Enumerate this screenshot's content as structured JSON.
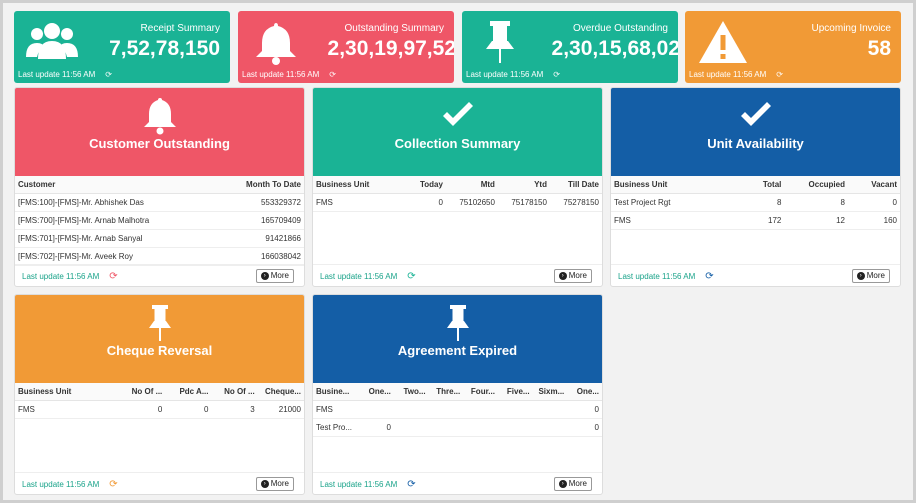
{
  "stats": [
    {
      "title": "Receipt Summary",
      "value": "7,52,78,150",
      "updated": "Last update 11:56 AM",
      "icon": "users-icon",
      "color": "#1ab395"
    },
    {
      "title": "Outstanding Summary",
      "value": "2,30,19,97,52",
      "updated": "Last update 11:56 AM",
      "icon": "bell-icon",
      "color": "#ef5667"
    },
    {
      "title": "Overdue Outstanding",
      "value": "2,30,15,68,02",
      "updated": "Last update 11:56 AM",
      "icon": "pin-icon",
      "color": "#1ab395"
    },
    {
      "title": "Upcoming Invoice",
      "value": "58",
      "updated": "Last update 11:56 AM",
      "icon": "warning-icon",
      "color": "#f19a36"
    }
  ],
  "refresh_glyph": "⟳",
  "more_label": "More",
  "more_glyph": "›",
  "customer_outstanding": {
    "title": "Customer Outstanding",
    "icon": "bell-icon",
    "columns": [
      "Customer",
      "Month To Date"
    ],
    "rows": [
      [
        "[FMS:100]-[FMS]-Mr. Abhishek Das",
        "553329372"
      ],
      [
        "[FMS:700]-[FMS]-Mr. Arnab Malhotra",
        "165709409"
      ],
      [
        "[FMS:701]-[FMS]-Mr. Arnab Sanyal",
        "91421866"
      ],
      [
        "[FMS:702]-[FMS]-Mr. Aveek Roy",
        "166038042"
      ]
    ],
    "updated": "Last update 11:56 AM"
  },
  "collection_summary": {
    "title": "Collection Summary",
    "icon": "check-icon",
    "columns": [
      "Business Unit",
      "Today",
      "Mtd",
      "Ytd",
      "Till Date"
    ],
    "rows": [
      [
        "FMS",
        "0",
        "75102650",
        "75178150",
        "75278150"
      ]
    ],
    "updated": "Last update 11:56 AM"
  },
  "unit_availability": {
    "title": "Unit Availability",
    "icon": "check-icon",
    "columns": [
      "Business Unit",
      "Total",
      "Occupied",
      "Vacant"
    ],
    "rows": [
      [
        "Test Project Rgt",
        "8",
        "8",
        "0"
      ],
      [
        "FMS",
        "172",
        "12",
        "160"
      ]
    ],
    "updated": "Last update 11:56 AM"
  },
  "cheque_reversal": {
    "title": "Cheque Reversal",
    "icon": "pin-icon",
    "columns": [
      "Business Unit",
      "No Of ...",
      "Pdc A...",
      "No Of ...",
      "Cheque..."
    ],
    "rows": [
      [
        "FMS",
        "0",
        "0",
        "3",
        "21000"
      ]
    ],
    "updated": "Last update 11:56 AM"
  },
  "agreement_expired": {
    "title": "Agreement Expired",
    "icon": "pin-icon",
    "columns": [
      "Busine...",
      "One...",
      "Two...",
      "Thre...",
      "Four...",
      "Five...",
      "Sixm...",
      "One..."
    ],
    "rows": [
      [
        "FMS",
        "",
        "",
        "",
        "",
        "",
        "",
        "0"
      ],
      [
        "Test Pro...",
        "0",
        "",
        "",
        "",
        "",
        "",
        "0"
      ]
    ],
    "updated": "Last update 11:56 AM"
  }
}
